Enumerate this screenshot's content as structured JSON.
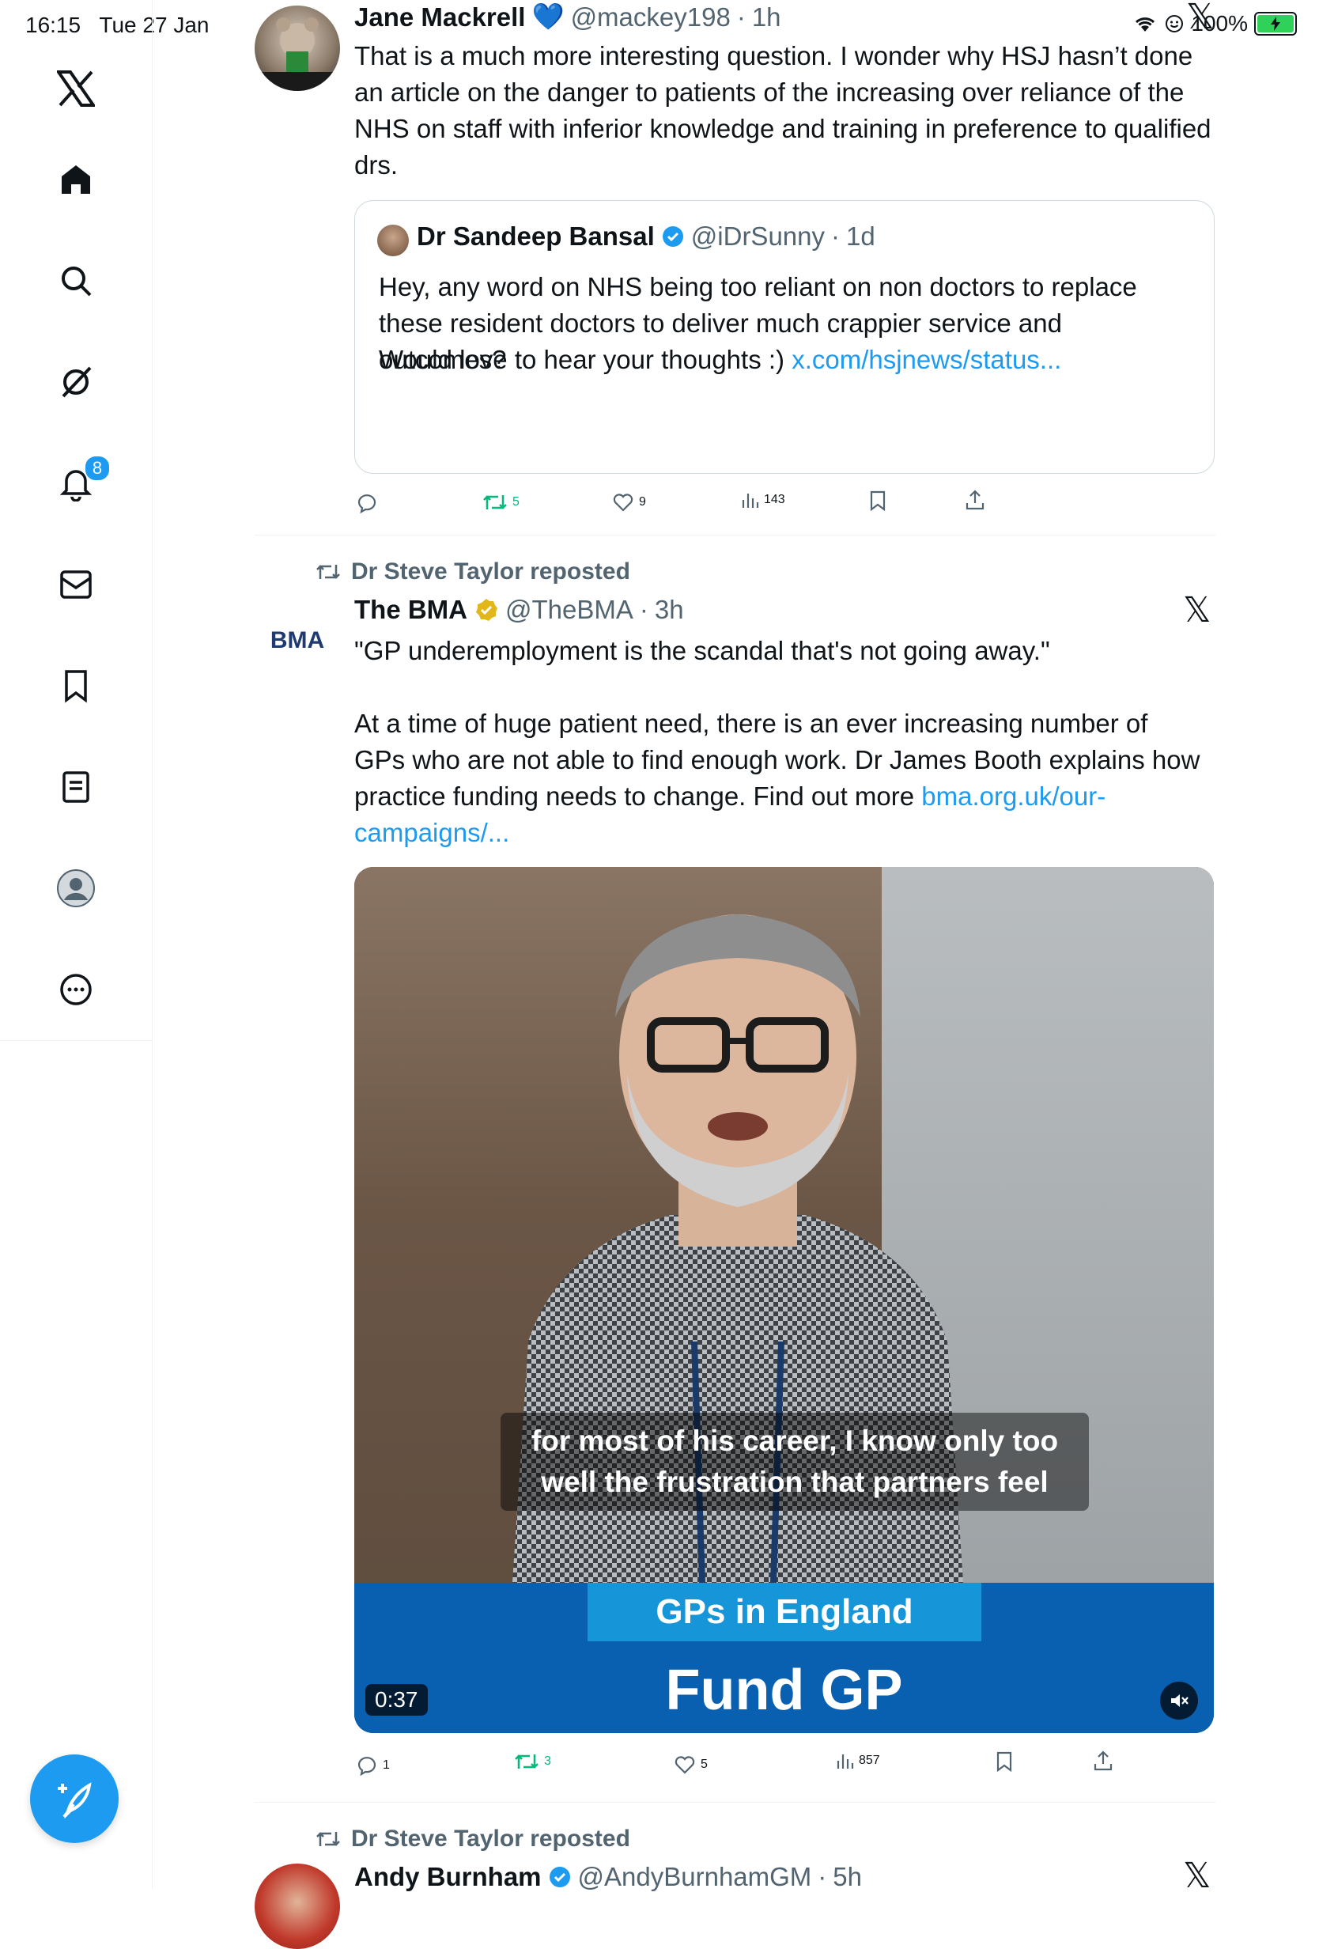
{
  "status": {
    "time": "16:15",
    "date": "Tue 27 Jan",
    "battery": "100%"
  },
  "sidebar": {
    "notifications_badge": "8"
  },
  "tweets": [
    {
      "author_name": "Jane Mackrell",
      "author_emoji": "💙",
      "handle": "@mackey198",
      "time": "1h",
      "text": "That is a much more interesting question. I wonder why HSJ hasn’t done an article on the danger to patients of the increasing over reliance of the NHS on staff with inferior knowledge and training in preference to qualified drs.",
      "quote": {
        "author_name": "Dr Sandeep Bansal",
        "handle": "@iDrSunny",
        "time": "1d",
        "text": "Hey, any word on NHS being too reliant on non doctors to replace these resident doctors to deliver much crappier service and outcomes?",
        "text2": "Would love to hear your thoughts :) ",
        "link": "x.com/hsjnews/status..."
      },
      "replies": "",
      "reposts": "5",
      "likes": "9",
      "views": "143"
    },
    {
      "repost_by": "Dr Steve Taylor reposted",
      "author_name": "The BMA",
      "handle": "@TheBMA",
      "time": "3h",
      "avatar_text": "BMA",
      "text_quote": "\"GP underemployment is the scandal that's not going away.\"",
      "text_body": "At a time of huge patient need, there is an ever increasing number of GPs who are not able to find enough work. Dr James Booth explains how practice funding needs to change. Find out more ",
      "link": "bma.org.uk/our-campaigns/...",
      "media": {
        "caption": "for most of his career, I know only too well the frustration that partners feel",
        "banner_tag": "GPs in England",
        "banner_title": "Fund GP",
        "duration": "0:37"
      },
      "replies": "1",
      "reposts": "3",
      "likes": "5",
      "views": "857"
    },
    {
      "repost_by": "Dr Steve Taylor reposted",
      "author_name": "Andy Burnham",
      "handle": "@AndyBurnhamGM",
      "time": "5h"
    }
  ],
  "colors": {
    "accent": "#1d9bf0",
    "repost_green": "#00ba7c",
    "muted": "#536471",
    "verified_blue": "#1d9bf0",
    "verified_gold": "#e2b719"
  }
}
